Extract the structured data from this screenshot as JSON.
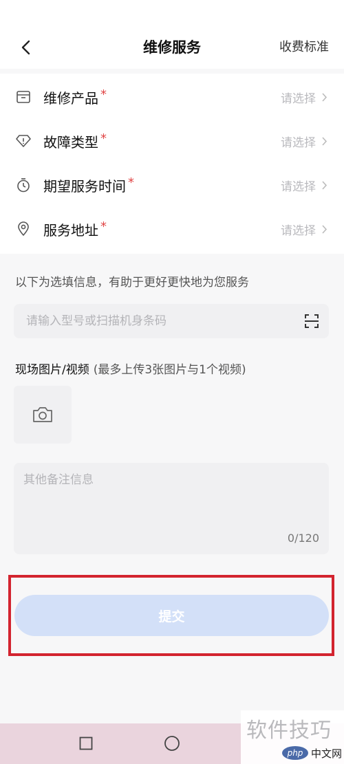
{
  "header": {
    "title": "维修服务",
    "fee_link": "收费标准"
  },
  "form": {
    "rows": [
      {
        "label": "维修产品",
        "required": "*",
        "value": "请选择",
        "icon": "product-box-icon"
      },
      {
        "label": "故障类型",
        "required": "*",
        "value": "请选择",
        "icon": "diamond-warning-icon"
      },
      {
        "label": "期望服务时间",
        "required": "*",
        "value": "请选择",
        "icon": "timer-icon"
      },
      {
        "label": "服务地址",
        "required": "*",
        "value": "请选择",
        "icon": "location-pin-icon"
      }
    ]
  },
  "optional": {
    "tip": "以下为选填信息，有助于更好更快地为您服务",
    "model_placeholder": "请输入型号或扫描机身条码",
    "model_value": ""
  },
  "media": {
    "title": "现场图片/视频",
    "hint": "(最多上传3张图片与1个视频)"
  },
  "remarks": {
    "placeholder": "其他备注信息",
    "value": "",
    "count": "0/120"
  },
  "submit": {
    "label": "提交"
  },
  "watermark": {
    "main": "软件技巧",
    "logo": "php",
    "site": "中文网"
  },
  "colors": {
    "accent_required": "#e04545",
    "submit_disabled": "#d3e0f8",
    "highlight": "#d3242f"
  }
}
